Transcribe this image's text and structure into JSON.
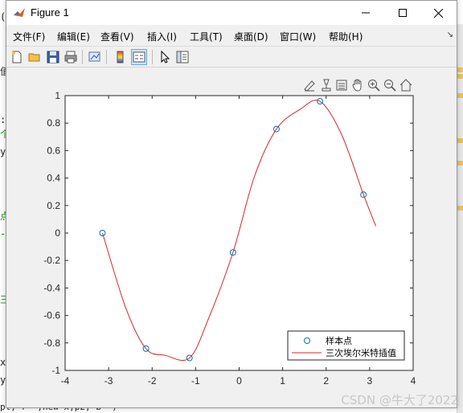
{
  "window": {
    "title": "Figure 1"
  },
  "menu": [
    "文件(F)",
    "编辑(E)",
    "查看(V)",
    "插入(I)",
    "工具(T)",
    "桌面(D)",
    "窗口(W)",
    "帮助(H)"
  ],
  "menu_more": "↘",
  "toolbar": [
    "new-figure-icon",
    "open-icon",
    "save-icon",
    "print-icon",
    "link-plot-icon",
    "colorbar-icon",
    "legend-icon",
    "pointer-icon",
    "property-inspector-icon"
  ],
  "axes_toolbar": [
    "brush-icon",
    "data-cursor-icon",
    "rotate-icon",
    "pan-icon",
    "zoom-in-icon",
    "zoom-out-icon",
    "home-icon"
  ],
  "chart_data": {
    "type": "line",
    "xlim": [
      -4,
      4
    ],
    "ylim": [
      -1,
      1
    ],
    "xticks": [
      "-4",
      "-3",
      "-2",
      "-1",
      "0",
      "1",
      "2",
      "3",
      "4"
    ],
    "yticks": [
      "1",
      "0.8",
      "0.6",
      "0.4",
      "0.2",
      "0",
      "-0.2",
      "-0.4",
      "-0.6",
      "-0.8",
      "-1"
    ],
    "series": [
      {
        "name": "样本点",
        "marker": "circle",
        "color": "#0072bd",
        "x": [
          -3.1416,
          -2.1416,
          -1.1416,
          -0.1416,
          0.8584,
          1.8584,
          2.8584
        ],
        "y": [
          0.0,
          -0.8415,
          -0.9093,
          -0.1411,
          0.7568,
          0.9589,
          0.2794
        ]
      },
      {
        "name": "三次埃尔米特插值",
        "line": "solid",
        "color": "#d62728",
        "x": [
          -3.1416,
          -2.6,
          -2.1416,
          -1.7,
          -1.1416,
          -0.7,
          -0.1416,
          0.35,
          0.8584,
          1.4,
          1.8584,
          2.35,
          2.8584,
          3.1416
        ],
        "y": [
          0.0,
          -0.55,
          -0.8415,
          -0.89,
          -0.9093,
          -0.62,
          -0.1411,
          0.41,
          0.7568,
          0.9,
          0.9589,
          0.72,
          0.2794,
          0.05
        ]
      }
    ],
    "legend": "bottom-right",
    "grid": false
  },
  "background_fragments": [
    "值",
    "(",
    ":)",
    "个",
    "y_",
    "点",
    "-从",
    "三",
    "x",
    "y",
    "pl, r- ,new x,p2, b- )"
  ],
  "watermark": "CSDN @牛大了2022"
}
